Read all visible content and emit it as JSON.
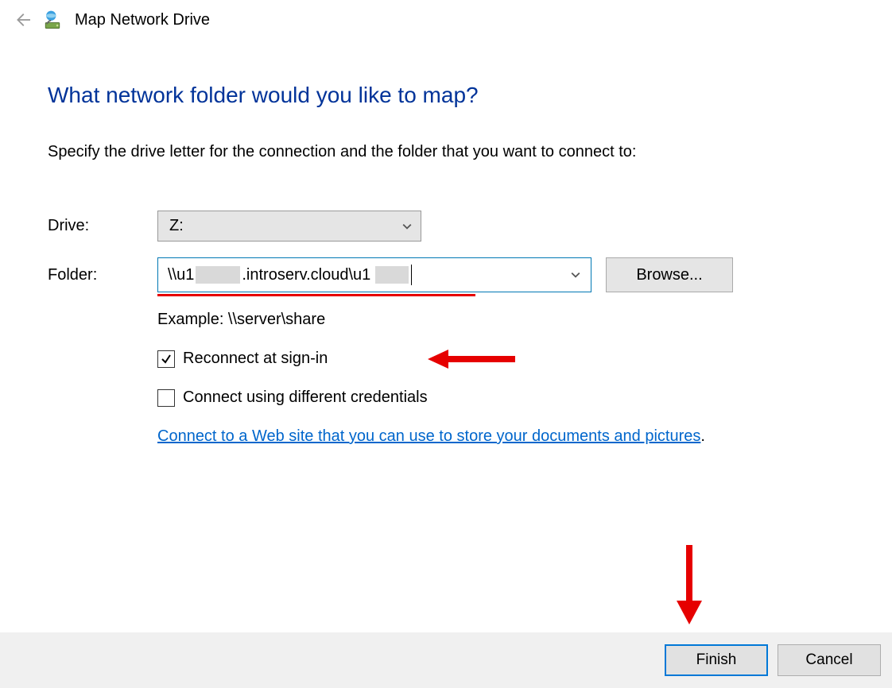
{
  "header": {
    "title": "Map Network Drive"
  },
  "main": {
    "heading": "What network folder would you like to map?",
    "intro": "Specify the drive letter for the connection and the folder that you want to connect to:",
    "drive": {
      "label": "Drive:",
      "value": "Z:"
    },
    "folder": {
      "label": "Folder:",
      "value_part1": "\\\\u1",
      "value_part2": ".introserv.cloud\\u1",
      "browse_label": "Browse...",
      "example": "Example: \\\\server\\share"
    },
    "checkboxes": {
      "reconnect": {
        "label": "Reconnect at sign-in",
        "checked": true
      },
      "credentials": {
        "label": "Connect using different credentials",
        "checked": false
      }
    },
    "link": {
      "text": "Connect to a Web site that you can use to store your documents and pictures",
      "trailing": "."
    }
  },
  "footer": {
    "finish": "Finish",
    "cancel": "Cancel"
  },
  "annotations": {
    "underline_color": "#e60000"
  }
}
